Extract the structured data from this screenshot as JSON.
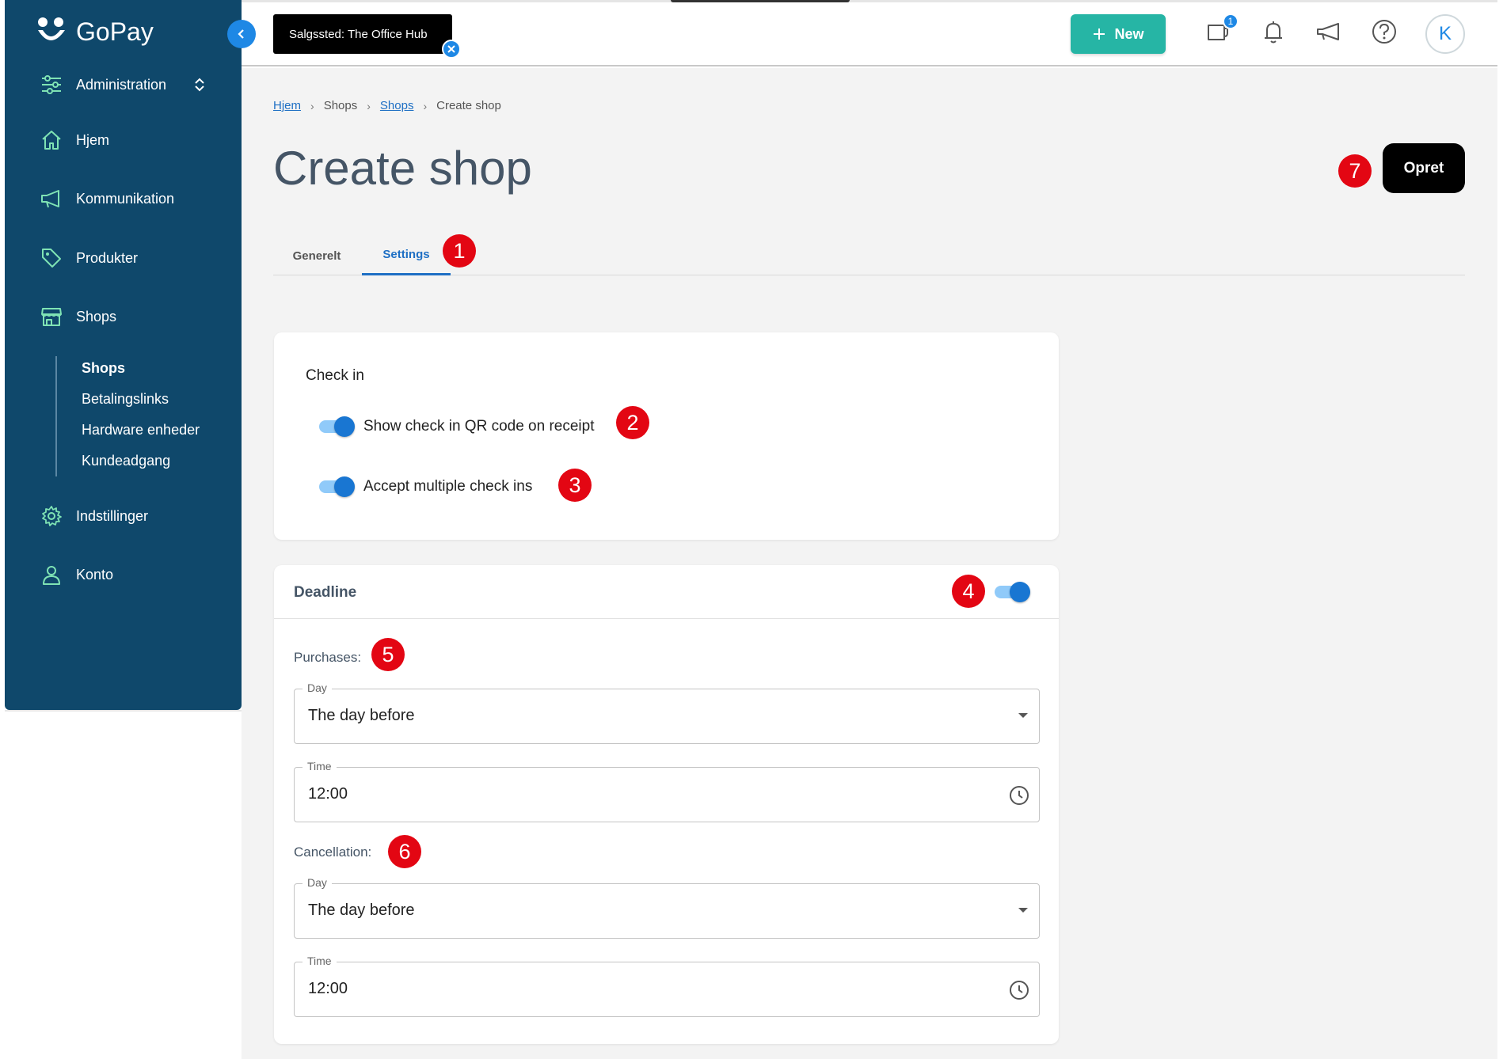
{
  "app": {
    "brand": "GoPay"
  },
  "sidebar": {
    "items": [
      {
        "label": "Administration",
        "icon": "sliders-icon"
      },
      {
        "label": "Hjem",
        "icon": "home-icon"
      },
      {
        "label": "Kommunikation",
        "icon": "megaphone-icon"
      },
      {
        "label": "Produkter",
        "icon": "tag-icon"
      },
      {
        "label": "Shops",
        "icon": "store-icon"
      },
      {
        "label": "Indstillinger",
        "icon": "gear-icon"
      },
      {
        "label": "Konto",
        "icon": "user-icon"
      }
    ],
    "subitems": [
      {
        "label": "Shops",
        "active": true
      },
      {
        "label": "Betalingslinks"
      },
      {
        "label": "Hardware enheder"
      },
      {
        "label": "Kundeadgang"
      }
    ]
  },
  "topbar": {
    "store_chip": "Salgssted: The Office Hub",
    "new_label": "New",
    "notifications_badge": "1",
    "avatar_initial": "K"
  },
  "breadcrumb": [
    "Hjem",
    "Shops",
    "Shops",
    "Create shop"
  ],
  "page": {
    "title": "Create shop",
    "primary_action": "Opret"
  },
  "tabs": [
    {
      "label": "Generelt"
    },
    {
      "label": "Settings",
      "active": true
    }
  ],
  "checkin": {
    "title": "Check in",
    "options": [
      {
        "label": "Show check in QR code on receipt",
        "enabled": true
      },
      {
        "label": "Accept multiple check ins",
        "enabled": true
      }
    ]
  },
  "deadline": {
    "title": "Deadline",
    "enabled": true,
    "purchases": {
      "label": "Purchases:",
      "day_legend": "Day",
      "day_value": "The day before",
      "time_legend": "Time",
      "time_value": "12:00"
    },
    "cancellation": {
      "label": "Cancellation:",
      "day_legend": "Day",
      "day_value": "The day before",
      "time_legend": "Time",
      "time_value": "12:00"
    }
  },
  "annotations": [
    "1",
    "2",
    "3",
    "4",
    "5",
    "6",
    "7"
  ],
  "colors": {
    "sidebar": "#0f486b",
    "accent": "#1e88e5",
    "new_button": "#26b5a5",
    "annotation": "#e30613",
    "icon_green": "#7fe3b4"
  }
}
